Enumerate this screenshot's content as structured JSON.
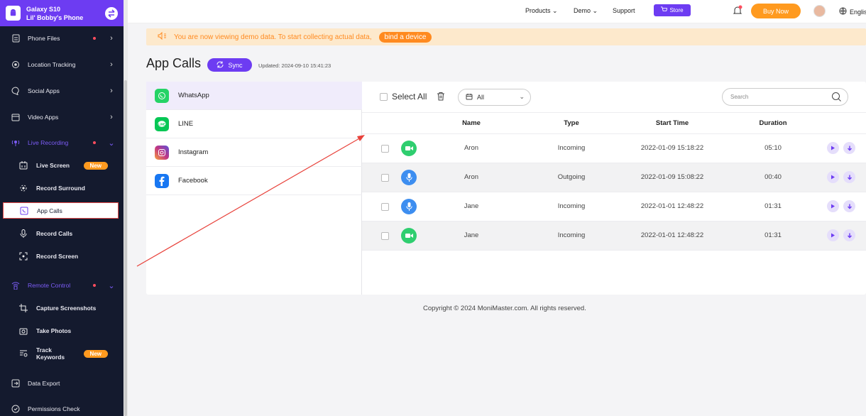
{
  "device": {
    "model": "Galaxy S10",
    "name": "Lil' Bobby's Phone"
  },
  "sidebar": {
    "items": [
      {
        "label": "Phone Files",
        "icon": "file-icon"
      },
      {
        "label": "Location Tracking",
        "icon": "location-icon"
      },
      {
        "label": "Social Apps",
        "icon": "chat-icon"
      },
      {
        "label": "Video Apps",
        "icon": "video-icon"
      },
      {
        "label": "Live Recording",
        "icon": "live-recording-icon"
      },
      {
        "label": "Live Screen",
        "badge": "New",
        "icon": "live-screen-icon"
      },
      {
        "label": "Record Surround",
        "icon": "record-surround-icon"
      },
      {
        "label": "App Calls",
        "icon": "app-calls-icon"
      },
      {
        "label": "Record Calls",
        "icon": "microphone-icon"
      },
      {
        "label": "Record Screen",
        "icon": "record-screen-icon"
      },
      {
        "label": "Remote Control",
        "icon": "remote-control-icon"
      },
      {
        "label": "Capture Screenshots",
        "icon": "crop-icon"
      },
      {
        "label": "Take Photos",
        "icon": "camera-icon"
      },
      {
        "label": "Track Keywords",
        "badge": "New",
        "icon": "keyword-icon"
      },
      {
        "label": "Data Export",
        "icon": "export-icon"
      },
      {
        "label": "Permissions Check",
        "icon": "permissions-icon"
      }
    ]
  },
  "topbar": {
    "products": "Products",
    "demo": "Demo",
    "support": "Support",
    "store": "Store",
    "buy_now": "Buy Now",
    "language": "Englis"
  },
  "banner": {
    "message": "You are now viewing demo data. To start collecting actual data,",
    "button": "bind a device"
  },
  "page": {
    "title": "App Calls",
    "sync": "Sync",
    "updated": "Updated: 2024-09-10 15:41:23"
  },
  "apps": [
    {
      "name": "WhatsApp",
      "icon": "whatsapp-icon",
      "color": "#25d366"
    },
    {
      "name": "LINE",
      "icon": "line-icon",
      "color": "#06c755"
    },
    {
      "name": "Instagram",
      "icon": "instagram-icon",
      "color": "#c13584"
    },
    {
      "name": "Facebook",
      "icon": "facebook-icon",
      "color": "#1877f2"
    }
  ],
  "table": {
    "select_all": "Select All",
    "filter_value": "All",
    "search_placeholder": "Search",
    "columns": [
      "Name",
      "Type",
      "Start Time",
      "Duration"
    ],
    "rows": [
      {
        "kind": "video-call-icon",
        "name": "Aron",
        "type": "Incoming",
        "start": "2022-01-09 15:18:22",
        "duration": "05:10"
      },
      {
        "kind": "voice-call-icon",
        "name": "Aron",
        "type": "Outgoing",
        "start": "2022-01-09 15:08:22",
        "duration": "00:40"
      },
      {
        "kind": "voice-call-icon",
        "name": "Jane",
        "type": "Incoming",
        "start": "2022-01-01 12:48:22",
        "duration": "01:31"
      },
      {
        "kind": "video-call-icon",
        "name": "Jane",
        "type": "Incoming",
        "start": "2022-01-01 12:48:22",
        "duration": "01:31"
      }
    ]
  },
  "footer": {
    "copyright": "Copyright © 2024 MoniMaster.com. All rights reserved."
  },
  "colors": {
    "accent": "#6d3cf2",
    "orange": "#ff9a1f",
    "sidebar": "#141a2e",
    "video": "#2fce6f",
    "voice": "#3d8ef0"
  }
}
